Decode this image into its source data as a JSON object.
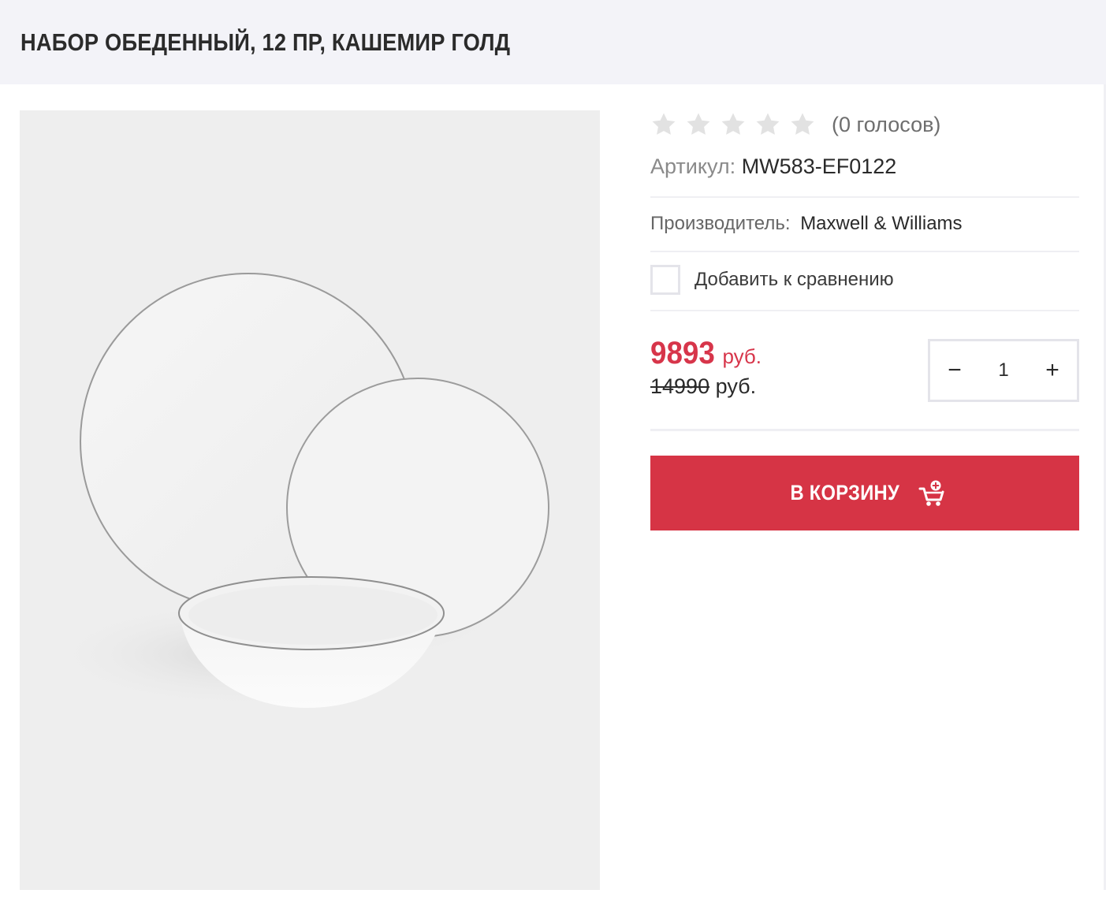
{
  "header": {
    "title": "НАБОР ОБЕДЕННЫЙ, 12 ПР, КАШЕМИР ГОЛД"
  },
  "product": {
    "image_alt": "Набор обеденный, 12 пр, Кашемир голд",
    "rating": {
      "stars_total": 5,
      "stars_filled": 0,
      "votes_text": "(0 голосов)"
    },
    "sku": {
      "label": "Артикул:",
      "value": "MW583-EF0122"
    },
    "brand": {
      "label": "Производитель:",
      "value": "Maxwell & Williams"
    },
    "compare": {
      "label": "Добавить к сравнению",
      "checked": false
    },
    "price": {
      "current": "9893",
      "current_currency": "руб.",
      "old": "14990",
      "old_currency": "руб."
    },
    "quantity": {
      "minus": "−",
      "value": "1",
      "plus": "+"
    },
    "cart_button": {
      "label": "В КОРЗИНУ",
      "icon": "cart-add-icon"
    }
  },
  "colors": {
    "accent": "#d63445",
    "price": "#d7354a",
    "star_empty": "#e2e2e2",
    "header_bg": "#f3f3f8",
    "image_bg": "#eeeeee"
  }
}
